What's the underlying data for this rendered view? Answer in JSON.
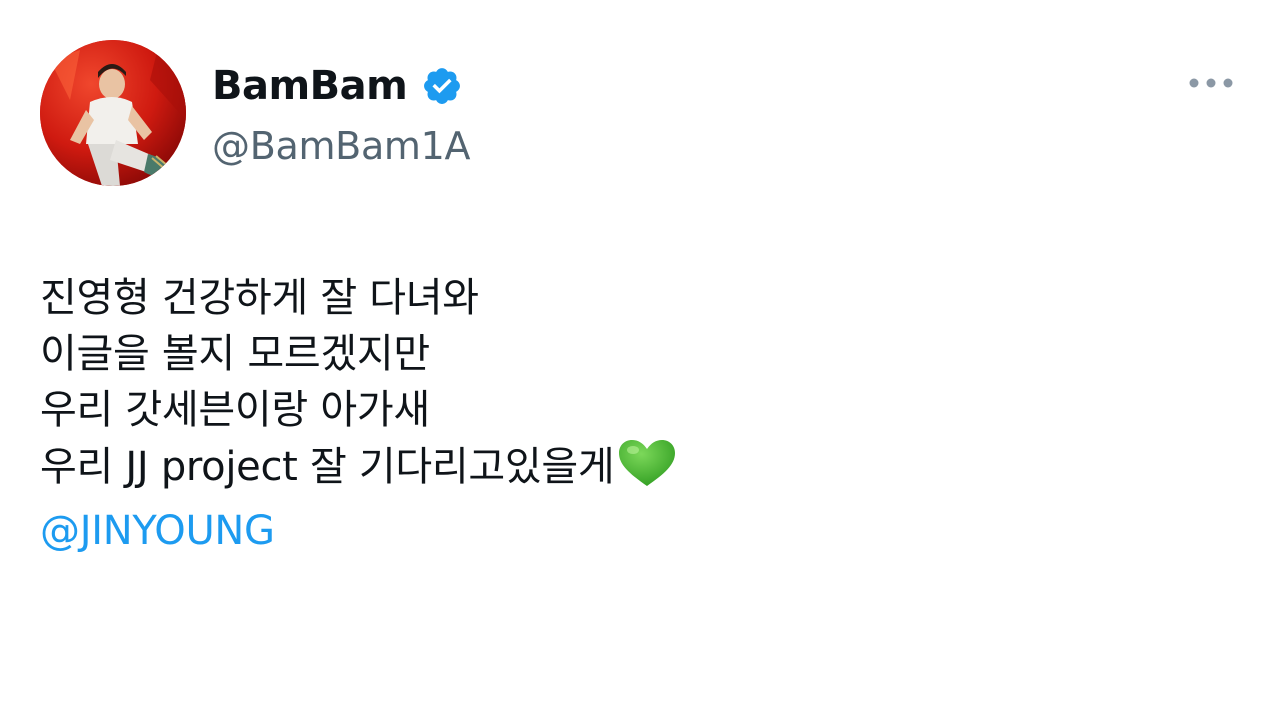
{
  "tweet": {
    "author": {
      "display_name": "BamBam",
      "handle": "@BamBam1A",
      "verified": true,
      "avatar_icon": "profile-photo"
    },
    "menu_icon": "more-horizontal-icon",
    "body_lines": [
      "진영형 건강하게 잘 다녀와",
      "이글을 볼지 모르겠지만",
      "우리 갓세븐이랑 아가새",
      "우리 JJ project 잘 기다리고있을게"
    ],
    "emoji": "green-heart-icon",
    "mention": "@JINYOUNG"
  },
  "colors": {
    "text": "#0f1419",
    "secondary": "#536471",
    "accent": "#1d9bf0",
    "heart": "#3fae2a"
  }
}
